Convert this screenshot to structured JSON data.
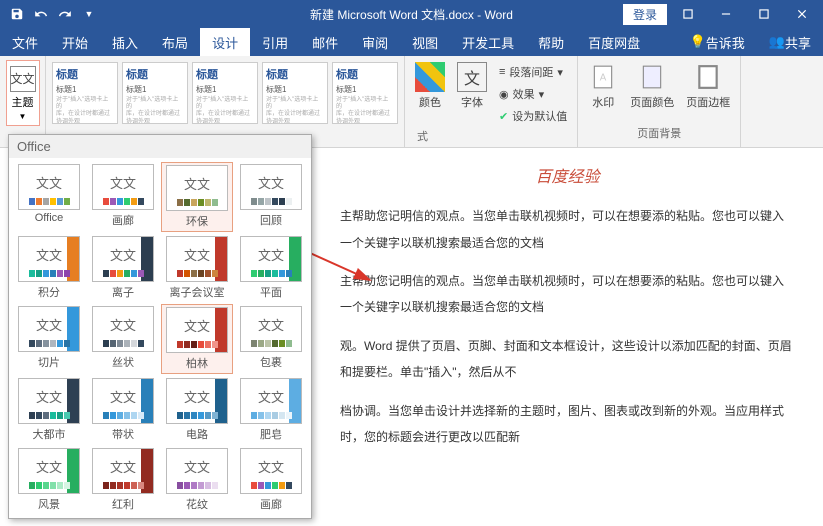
{
  "titlebar": {
    "title": "新建 Microsoft Word 文档.docx - Word",
    "login": "登录"
  },
  "tabs": {
    "file": "文件",
    "home": "开始",
    "insert": "插入",
    "layout": "布局",
    "design": "设计",
    "references": "引用",
    "mailings": "邮件",
    "review": "审阅",
    "view": "视图",
    "developer": "开发工具",
    "help": "帮助",
    "baidu": "百度网盘",
    "tellme": "告诉我",
    "share": "共享"
  },
  "ribbon": {
    "theme_label": "主题",
    "theme_icon": "文文",
    "styles": [
      {
        "h": "标题",
        "sub": "标题1"
      },
      {
        "h": "标题",
        "sub": "标题1"
      },
      {
        "h": "标题",
        "sub": "标题1"
      },
      {
        "h": "标题",
        "sub": "标题1"
      },
      {
        "h": "标题",
        "sub": "标题1"
      }
    ],
    "colors": "颜色",
    "fonts": "字体",
    "font_icon": "文",
    "spacing": "段落间距",
    "effects": "效果",
    "setdefault": "设为默认值",
    "watermark": "水印",
    "pagecolor": "页面颜色",
    "pageborder": "页面边框",
    "group_bg": "页面背景",
    "group_fmt": "式"
  },
  "dropdown": {
    "header": "Office",
    "items": [
      {
        "name": "Office",
        "colors": [
          "#4472c4",
          "#ed7d31",
          "#a5a5a5",
          "#ffc000",
          "#5b9bd5",
          "#70ad47"
        ]
      },
      {
        "name": "画廊",
        "colors": [
          "#e84c3d",
          "#9b59b6",
          "#3498db",
          "#2ecc71",
          "#f39c12",
          "#34495e"
        ]
      },
      {
        "name": "环保",
        "colors": [
          "#8b6f47",
          "#556b2f",
          "#c9a55c",
          "#6b8e23",
          "#bdb76b",
          "#8fbc8f"
        ],
        "sel": true
      },
      {
        "name": "回顾",
        "colors": [
          "#7f8c8d",
          "#95a5a6",
          "#bdc3c7",
          "#34495e",
          "#2c3e50",
          "#ecf0f1"
        ]
      },
      {
        "name": "积分",
        "colors": [
          "#1abc9c",
          "#16a085",
          "#3498db",
          "#2980b9",
          "#9b59b6",
          "#8e44ad"
        ],
        "accent": "#e67e22"
      },
      {
        "name": "离子",
        "colors": [
          "#2c3e50",
          "#e74c3c",
          "#f39c12",
          "#27ae60",
          "#3498db",
          "#9b59b6"
        ],
        "accent": "#2c3e50"
      },
      {
        "name": "离子会议室",
        "colors": [
          "#c0392b",
          "#d35400",
          "#8b6f47",
          "#6b4423",
          "#a0522d",
          "#cd853f"
        ],
        "accent": "#c0392b"
      },
      {
        "name": "平面",
        "colors": [
          "#2ecc71",
          "#27ae60",
          "#16a085",
          "#1abc9c",
          "#3498db",
          "#2980b9"
        ],
        "accent": "#27ae60"
      },
      {
        "name": "切片",
        "colors": [
          "#34495e",
          "#5d6d7e",
          "#85929e",
          "#aeb6bf",
          "#3498db",
          "#2874a6"
        ],
        "accent": "#3498db"
      },
      {
        "name": "丝状",
        "colors": [
          "#2c3e50",
          "#566573",
          "#808b96",
          "#abb2b9",
          "#d5d8dc",
          "#34495e"
        ]
      },
      {
        "name": "柏林",
        "colors": [
          "#c0392b",
          "#922b21",
          "#641e16",
          "#e74c3c",
          "#ec7063",
          "#f1948a"
        ],
        "accent": "#c0392b",
        "sel2": true
      },
      {
        "name": "包裹",
        "colors": [
          "#7d8471",
          "#9ca986",
          "#bcc4a8",
          "#556b2f",
          "#6b8e23",
          "#8fbc8f"
        ]
      },
      {
        "name": "大都市",
        "colors": [
          "#2e4053",
          "#34495e",
          "#5d6d7e",
          "#1abc9c",
          "#16a085",
          "#48c9b0"
        ],
        "accent": "#2e4053"
      },
      {
        "name": "带状",
        "colors": [
          "#2980b9",
          "#3498db",
          "#5dade2",
          "#85c1e9",
          "#aed6f1",
          "#d6eaf8"
        ],
        "accent": "#2980b9"
      },
      {
        "name": "电路",
        "colors": [
          "#1f618d",
          "#2874a6",
          "#2e86c1",
          "#3498db",
          "#5499c7",
          "#7fb3d5"
        ],
        "accent": "#1f618d"
      },
      {
        "name": "肥皂",
        "colors": [
          "#5dade2",
          "#85c1e9",
          "#aed6f1",
          "#a9cce3",
          "#d4e6f1",
          "#ebf5fb"
        ],
        "accent": "#5dade2"
      },
      {
        "name": "风景",
        "colors": [
          "#27ae60",
          "#2ecc71",
          "#58d68d",
          "#82e0aa",
          "#abebc6",
          "#d5f5e3"
        ],
        "accent": "#27ae60"
      },
      {
        "name": "红利",
        "colors": [
          "#7b241c",
          "#922b21",
          "#a93226",
          "#c0392b",
          "#cd6155",
          "#d98880"
        ],
        "accent": "#922b21"
      },
      {
        "name": "花纹",
        "colors": [
          "#884ea0",
          "#9b59b6",
          "#af7ac5",
          "#c39bd3",
          "#d7bde2",
          "#ebdef0"
        ]
      },
      {
        "name": "画廊",
        "colors": [
          "#e84c3d",
          "#9b59b6",
          "#3498db",
          "#2ecc71",
          "#f39c12",
          "#34495e"
        ]
      }
    ]
  },
  "doc": {
    "title": "百度经验",
    "p1": "主帮助您记明信的观点。当您单击联机视频时，可以在想要添的粘贴。您也可以键入一个关键字以联机搜索最适合您的文档",
    "p2": "主帮助您记明信的观点。当您单击联机视频时，可以在想要添的粘贴。您也可以键入一个关键字以联机搜索最适合您的文档",
    "p3": "观。Word 提供了页眉、页脚、封面和文本框设计，这些设计以添加匹配的封面、页眉和提要栏。单击\"插入\"，然后从不",
    "p4": "档协调。当您单击设计并选择新的主题时，图片、图表或改到新的外观。当应用样式时，您的标题会进行更改以匹配新"
  }
}
